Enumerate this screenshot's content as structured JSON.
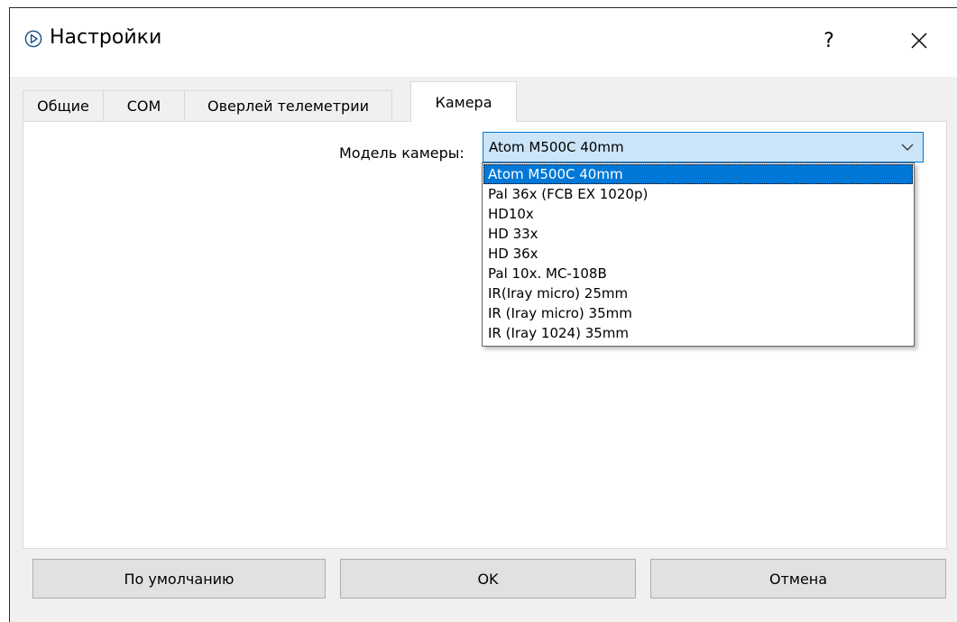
{
  "window": {
    "title": "Настройки"
  },
  "titlebar": {
    "help_label": "?",
    "close_icon": "close-icon",
    "app_icon": "play-circle-icon"
  },
  "tabs": [
    {
      "label": "Общие"
    },
    {
      "label": "COM"
    },
    {
      "label": "Оверлей телеметрии"
    },
    {
      "label": "Камера",
      "active": true
    }
  ],
  "camera": {
    "label": "Модель камеры:",
    "selected": "Atom M500C 40mm",
    "options": [
      "Atom M500C 40mm",
      "Pal 36x (FCB EX 1020p)",
      "HD10x",
      "HD 33x",
      "HD 36x",
      "Pal 10x.  MC-108B",
      "IR(Iray micro) 25mm",
      "IR (Iray micro) 35mm",
      "IR (Iray  1024) 35mm"
    ]
  },
  "buttons": {
    "defaults": "По умолчанию",
    "ok": "OK",
    "cancel": "Отмена"
  },
  "colors": {
    "accent": "#0078d7",
    "combo_bg": "#cce4f7",
    "dialog_bg": "#f0f0f0"
  }
}
